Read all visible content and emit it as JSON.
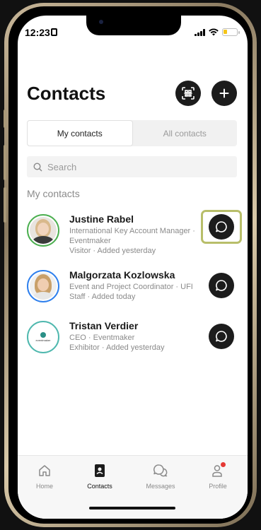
{
  "status_bar": {
    "time": "12:23"
  },
  "header": {
    "title": "Contacts"
  },
  "tabs": [
    {
      "label": "My contacts",
      "active": true
    },
    {
      "label": "All contacts",
      "active": false
    }
  ],
  "search": {
    "placeholder": "Search"
  },
  "section": {
    "label": "My contacts"
  },
  "contacts": [
    {
      "name": "Justine Rabel",
      "meta": "International Key Account Manager · Eventmaker\nVisitor · Added yesterday",
      "ring_color": "#4caf50"
    },
    {
      "name": "Malgorzata Kozlowska",
      "meta": "Event and Project Coordinator · UFI Staff · Added today",
      "ring_color": "#2f80ed"
    },
    {
      "name": "Tristan Verdier",
      "meta": "CEO · Eventmaker\nExhibitor · Added yesterday",
      "ring_color": "#4fb8ae",
      "logo_text": "eventmaker"
    }
  ],
  "tabbar": {
    "items": [
      {
        "label": "Home",
        "icon": "home-icon"
      },
      {
        "label": "Contacts",
        "icon": "contacts-icon",
        "active": true
      },
      {
        "label": "Messages",
        "icon": "messages-icon"
      },
      {
        "label": "Profile",
        "icon": "profile-icon",
        "badge_color": "#e53935"
      }
    ]
  },
  "colors": {
    "accent_dark": "#1c1c1c",
    "highlight": "#b8be6a"
  }
}
